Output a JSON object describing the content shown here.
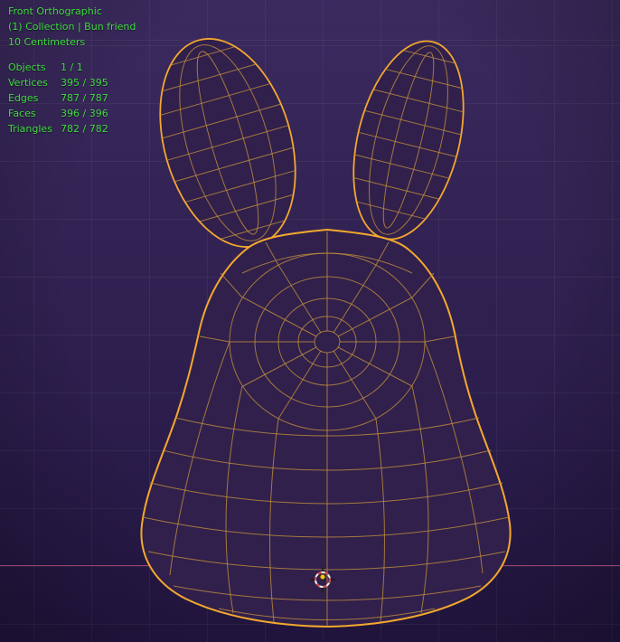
{
  "viewport": {
    "view_name": "Front Orthographic",
    "collection_line": "(1) Collection | Bun friend",
    "scale_line": "10 Centimeters",
    "stats": [
      {
        "label": "Objects",
        "value": "1 / 1"
      },
      {
        "label": "Vertices",
        "value": "395 / 395"
      },
      {
        "label": "Edges",
        "value": "787 / 787"
      },
      {
        "label": "Faces",
        "value": "396 / 396"
      },
      {
        "label": "Triangles",
        "value": "782 / 782"
      }
    ]
  },
  "colors": {
    "bg_top": "#3b2a5e",
    "bg_bottom": "#231642",
    "grid_line": "rgba(255,255,255,0.05)",
    "axis_x": "#b04a78",
    "overlay_text": "#3ddc3d",
    "wire": "#c08f3e",
    "outline": "#f3a82e",
    "mesh_fill": "#31204b"
  }
}
